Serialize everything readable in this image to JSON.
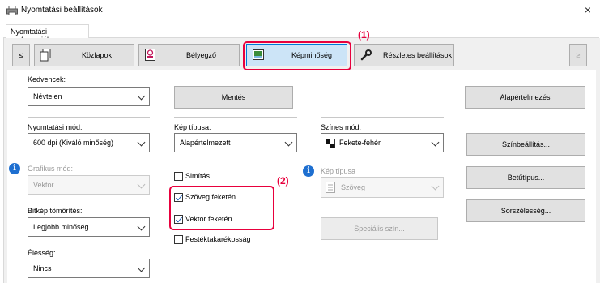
{
  "window": {
    "title": "Nyomtatási beállítások",
    "close": "×"
  },
  "tabs": [
    {
      "label": "Nyomtatási preferenciák"
    }
  ],
  "ribbon": {
    "prev": "≤",
    "next": "≥",
    "items": [
      {
        "label": "Közlapok",
        "icon": "pages-icon"
      },
      {
        "label": "Bélyegző",
        "icon": "stamp-icon"
      },
      {
        "label": "Képminőség",
        "icon": "image-quality-icon",
        "selected": true
      },
      {
        "label": "Részletes beállítások",
        "icon": "wrench-icon"
      }
    ]
  },
  "annotations": {
    "one": "(1)",
    "two": "(2)"
  },
  "favorites": {
    "label": "Kedvencek:",
    "value": "Névtelen",
    "save": "Mentés",
    "defaults": "Alapértelmezés"
  },
  "print_mode": {
    "label": "Nyomtatási mód:",
    "value": "600 dpi (Kiváló minőség)"
  },
  "graphics_mode": {
    "label": "Grafikus mód:",
    "value": "Vektor"
  },
  "bitmap": {
    "label": "Bitkép tömörítés:",
    "value": "Legjobb minőség"
  },
  "sharpness": {
    "label": "Élesség:",
    "value": "Nincs"
  },
  "image_type": {
    "label": "Kép típusa:",
    "value": "Alapértelmezett"
  },
  "checkboxes": {
    "smoothing": {
      "label": "Simítás",
      "checked": false
    },
    "text_black": {
      "label": "Szöveg feketén",
      "checked": true
    },
    "vector_black": {
      "label": "Vektor feketén",
      "checked": true
    },
    "toner_save": {
      "label": "Festéktakarékosság",
      "checked": false
    }
  },
  "color_mode": {
    "label": "Színes mód:",
    "value": "Fekete-fehér"
  },
  "image_type2": {
    "label": "Kép típusa",
    "value": "Szöveg"
  },
  "buttons": {
    "special_color": "Speciális szín...",
    "color_settings": "Színbeállítás...",
    "font_type": "Betűtípus...",
    "line_width": "Sorszélesség..."
  }
}
